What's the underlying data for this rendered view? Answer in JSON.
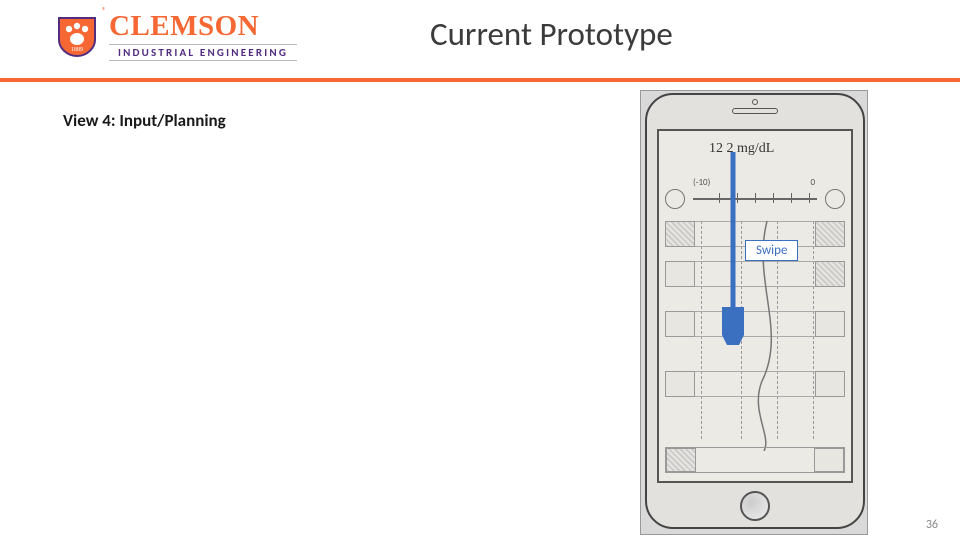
{
  "brand": {
    "name": "CLEMSON",
    "department": "INDUSTRIAL ENGINEERING",
    "year": "1889",
    "reg_mark": "®",
    "accent_color": "#F66733",
    "secondary_color": "#522D80"
  },
  "slide": {
    "title": "Current Prototype",
    "subtitle": "View 4: Input/Planning",
    "page_number": "36"
  },
  "mockup": {
    "reading_value": "12 2 mg/dL",
    "swipe_label": "Swipe",
    "axis_labels": {
      "left": "(-10)",
      "right": "0"
    }
  }
}
